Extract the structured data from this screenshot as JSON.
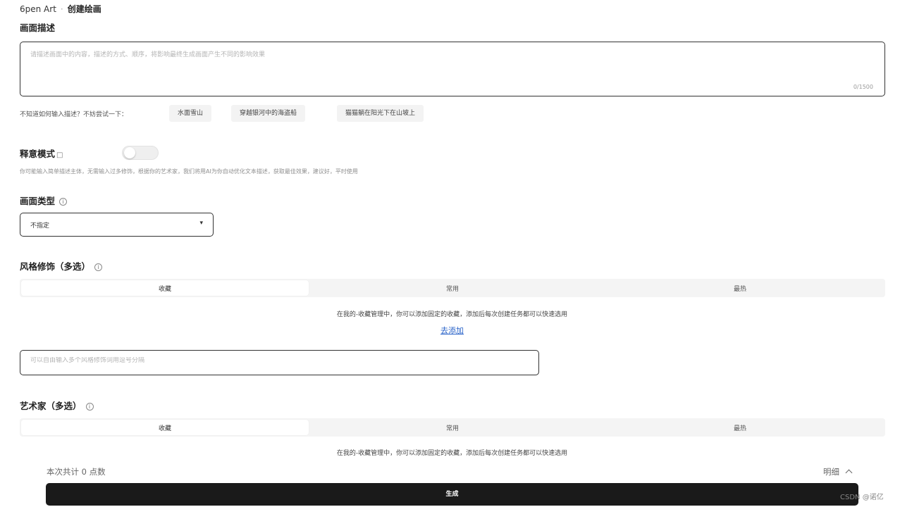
{
  "breadcrumb": {
    "root": "6pen Art",
    "current": "创建绘画"
  },
  "description": {
    "title": "画面描述",
    "placeholder": "请描述画面中的内容，描述的方式、顺序，将影响最终生成画面产生不同的影响效果",
    "value": "",
    "char_count": "0/1500"
  },
  "suggestions": {
    "label": "不知道如何输入描述？不妨尝试一下：",
    "chips": [
      "水面雪山",
      "穿越银河中的海盗船",
      "猫猫躺在阳光下在山坡上"
    ]
  },
  "mode": {
    "title": "释意模式",
    "toggle_on": false,
    "hint": "你可能输入简单描述主体，无需输入过多修饰，根据你的艺术家，我们将用AI为你自动优化文本描述，获取最佳效果，建议好，平时使用"
  },
  "picture_type": {
    "title": "画面类型",
    "selected": "不指定",
    "caret": "▾"
  },
  "style": {
    "title": "风格修饰（多选）",
    "tabs": [
      "收藏",
      "常用",
      "最热"
    ],
    "active_tab": 0,
    "hint": "在我的-收藏管理中，你可以添加固定的收藏，添加后每次创建任务都可以快速选用",
    "add_link": "去添加",
    "input_placeholder": "可以自由输入多个风格修饰词用逗号分隔"
  },
  "artist": {
    "title": "艺术家（多选）",
    "tabs": [
      "收藏",
      "常用",
      "最热"
    ],
    "active_tab": 0,
    "hint": "在我的-收藏管理中，你可以添加固定的收藏，添加后每次创建任务都可以快速选用"
  },
  "footer": {
    "cost": "本次共计 0 点数",
    "detail": "明细",
    "detail_icon": "chevron-up-icon",
    "generate_label": "生成"
  },
  "watermark": "CSDN @诺亿",
  "colors": {
    "primary_dark": "#1a1a1a",
    "link": "#2a63c9"
  }
}
